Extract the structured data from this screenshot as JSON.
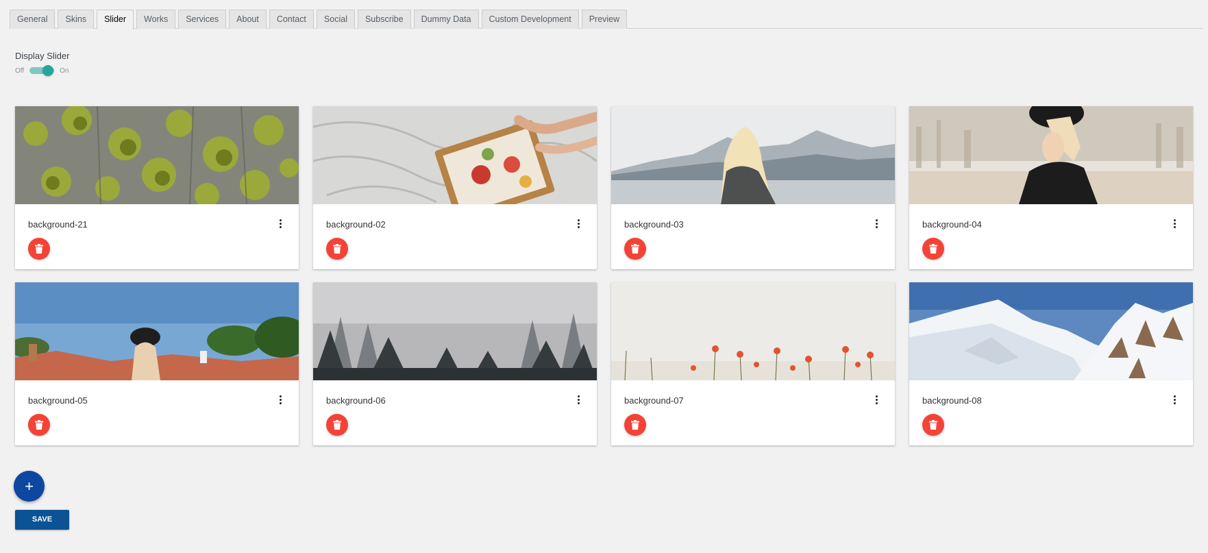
{
  "tabs": [
    {
      "label": "General"
    },
    {
      "label": "Skins"
    },
    {
      "label": "Slider",
      "active": true
    },
    {
      "label": "Works"
    },
    {
      "label": "Services"
    },
    {
      "label": "About"
    },
    {
      "label": "Contact"
    },
    {
      "label": "Social"
    },
    {
      "label": "Subscribe"
    },
    {
      "label": "Dummy Data"
    },
    {
      "label": "Custom Development"
    },
    {
      "label": "Preview"
    }
  ],
  "display_slider": {
    "label": "Display Slider",
    "off_label": "Off",
    "on_label": "On",
    "value": "on"
  },
  "slides": [
    {
      "name": "background-21",
      "image": "moss-bark"
    },
    {
      "name": "background-02",
      "image": "breakfast-tray-bed"
    },
    {
      "name": "background-03",
      "image": "woman-mountain-lake"
    },
    {
      "name": "background-04",
      "image": "woman-black-hat"
    },
    {
      "name": "background-05",
      "image": "woman-cap-rooftops"
    },
    {
      "name": "background-06",
      "image": "foggy-forest"
    },
    {
      "name": "background-07",
      "image": "poppy-field"
    },
    {
      "name": "background-08",
      "image": "snowy-mountains"
    }
  ],
  "icons": {
    "delete": "trash-icon",
    "more": "more-vertical-icon",
    "add": "plus-icon"
  },
  "add_button": {
    "label": "+"
  },
  "save_button": {
    "label": "SAVE"
  },
  "colors": {
    "accent": "#0d47a1",
    "save": "#0b5394",
    "delete": "#f44336",
    "toggle": "#26a69a"
  }
}
